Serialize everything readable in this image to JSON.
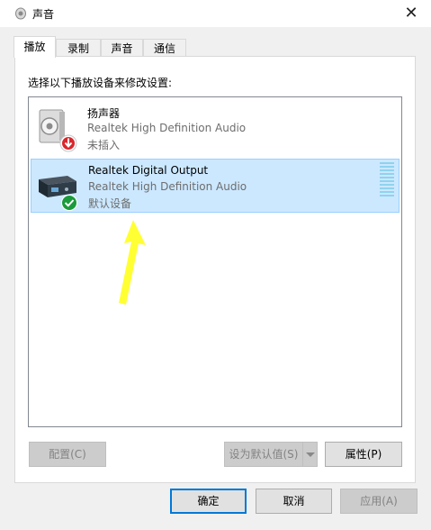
{
  "window": {
    "title": "声音",
    "close_glyph": "✕"
  },
  "tabs": [
    {
      "label": "播放",
      "active": true
    },
    {
      "label": "录制",
      "active": false
    },
    {
      "label": "声音",
      "active": false
    },
    {
      "label": "通信",
      "active": false
    }
  ],
  "panel": {
    "instruction": "选择以下播放设备来修改设置:"
  },
  "devices": [
    {
      "name": "扬声器",
      "driver": "Realtek High Definition Audio",
      "status": "未插入",
      "icon": "speaker-icon",
      "badge": "unplugged-badge-icon",
      "selected": false
    },
    {
      "name": "Realtek Digital Output",
      "driver": "Realtek High Definition Audio",
      "status": "默认设备",
      "icon": "digital-output-icon",
      "badge": "default-check-badge-icon",
      "selected": true
    }
  ],
  "panel_buttons": {
    "configure": "配置(C)",
    "set_default": "设为默认值(S)",
    "properties": "属性(P)"
  },
  "dialog_buttons": {
    "ok": "确定",
    "cancel": "取消",
    "apply": "应用(A)"
  },
  "colors": {
    "selection": "#cce8ff",
    "accent": "#0078d7",
    "annotation_arrow": "#ffff33"
  }
}
